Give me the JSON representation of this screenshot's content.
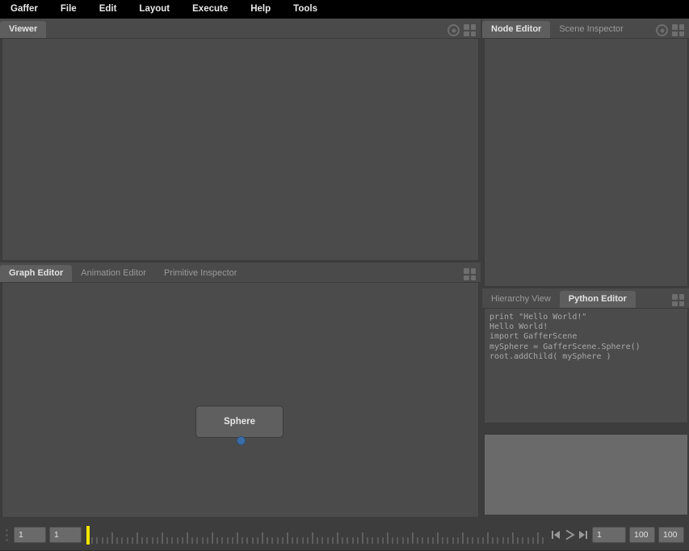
{
  "app": {
    "title": "Gaffer"
  },
  "menubar": {
    "items": [
      {
        "label": "Gaffer",
        "name": "menu-gaffer"
      },
      {
        "label": "File",
        "name": "menu-file"
      },
      {
        "label": "Edit",
        "name": "menu-edit"
      },
      {
        "label": "Layout",
        "name": "menu-layout"
      },
      {
        "label": "Execute",
        "name": "menu-execute"
      },
      {
        "label": "Help",
        "name": "menu-help"
      },
      {
        "label": "Tools",
        "name": "menu-tools"
      }
    ]
  },
  "viewer_panel": {
    "tabs": [
      {
        "label": "Viewer",
        "active": true
      }
    ],
    "tools": [
      {
        "icon": "target-icon"
      },
      {
        "icon": "layout-grid-icon"
      }
    ]
  },
  "graph_panel": {
    "tabs": [
      {
        "label": "Graph Editor",
        "active": true
      },
      {
        "label": "Animation Editor",
        "active": false
      },
      {
        "label": "Primitive Inspector",
        "active": false
      }
    ],
    "tools": [
      {
        "icon": "layout-grid-icon"
      }
    ],
    "nodes": [
      {
        "label": "Sphere"
      }
    ]
  },
  "node_editor_panel": {
    "tabs": [
      {
        "label": "Node Editor",
        "active": true
      },
      {
        "label": "Scene Inspector",
        "active": false
      }
    ],
    "tools": [
      {
        "icon": "target-icon"
      },
      {
        "icon": "layout-grid-icon"
      }
    ]
  },
  "python_panel": {
    "tabs": [
      {
        "label": "Hierarchy View",
        "active": false
      },
      {
        "label": "Python Editor",
        "active": true
      }
    ],
    "tools": [
      {
        "icon": "layout-grid-icon"
      }
    ],
    "output_lines": [
      "print \"Hello World!\"",
      "Hello World!",
      "import GafferScene",
      "mySphere = GafferScene.Sphere()",
      "root.addChild( mySphere )"
    ],
    "input_value": ""
  },
  "timeline": {
    "start_frame": "1",
    "current_frame": "1",
    "playback_frame": "1",
    "end_frame": "100",
    "range_end": "100",
    "playhead_position_percent": 0,
    "transport": [
      {
        "name": "jump-to-start-button",
        "icon": "skip-back-icon"
      },
      {
        "name": "play-button",
        "icon": "play-icon"
      },
      {
        "name": "jump-to-end-button",
        "icon": "skip-forward-icon"
      }
    ]
  },
  "colors": {
    "menubar_bg": "#000000",
    "panel_bg": "#3d3d3d",
    "tabbar_bg": "#4a4a4a",
    "tab_active_bg": "#5e5e5e",
    "body_bg": "#4b4b4b",
    "node_bg": "#5f5f5f",
    "plug_blue": "#3a6ea8",
    "playhead_yellow": "#f2e500",
    "input_bg": "#6a6a6a"
  }
}
